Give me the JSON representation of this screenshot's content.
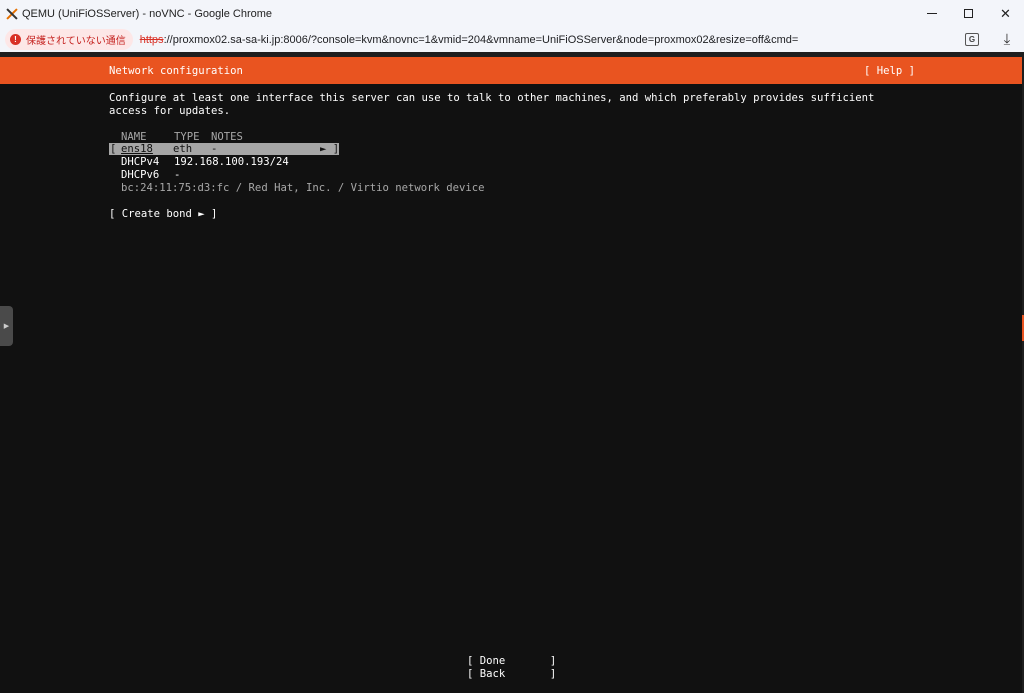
{
  "window": {
    "title": "QEMU (UniFiOSServer) - noVNC - Google Chrome",
    "minimize": "—",
    "maximize": "□",
    "close": "✕"
  },
  "address_bar": {
    "security_label": "保護されていない通信",
    "url_scheme": "https",
    "url_rest": "://proxmox02.sa-sa-ki.jp:8006/?console=kvm&novnc=1&vmid=204&vmname=UniFiOSServer&node=proxmox02&resize=off&cmd="
  },
  "installer": {
    "header_title": "Network configuration",
    "help_label": "[ Help ]",
    "description_line1": "Configure at least one interface this server can use to talk to other machines, and which preferably provides sufficient",
    "description_line2": "access for updates.",
    "columns": [
      "NAME",
      "TYPE",
      "NOTES"
    ],
    "interface": {
      "bracket_open": "[",
      "name": "ens18",
      "type": "eth",
      "notes": "-",
      "arrow": "► ]",
      "dhcpv4_label": "DHCPv4",
      "dhcpv4_value": "192.168.100.193/24",
      "dhcpv6_label": "DHCPv6",
      "dhcpv6_value": "-",
      "hw_info": "bc:24:11:75:d3:fc / Red Hat, Inc. / Virtio network device"
    },
    "create_bond": "[ Create bond ► ]",
    "done_button": "[ Done       ]",
    "back_button": "[ Back       ]"
  },
  "colors": {
    "accent": "#e95420",
    "terminal_bg": "#111111",
    "selection": "#a6a6a6"
  }
}
